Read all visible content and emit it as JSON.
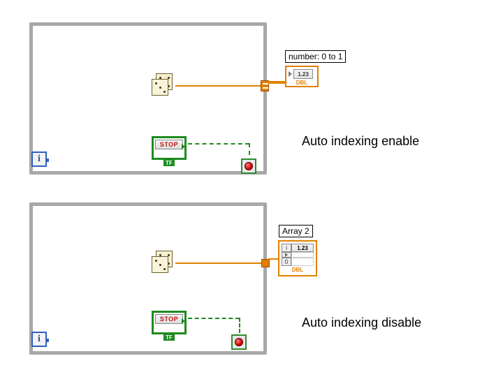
{
  "top": {
    "indicator_label": "number: 0 to 1",
    "indicator_value": "1.23",
    "indicator_type": "DBL",
    "stop_label": "STOP",
    "stop_tf": "TF",
    "i_label": "i",
    "caption": "Auto indexing enable"
  },
  "bottom": {
    "indicator_label": "Array 2",
    "indicator_value": "1.23",
    "indicator_type": "DBL",
    "idx0": "i",
    "idx1": "0",
    "stop_label": "STOP",
    "stop_tf": "TF",
    "i_label": "i",
    "caption": "Auto indexing disable"
  }
}
